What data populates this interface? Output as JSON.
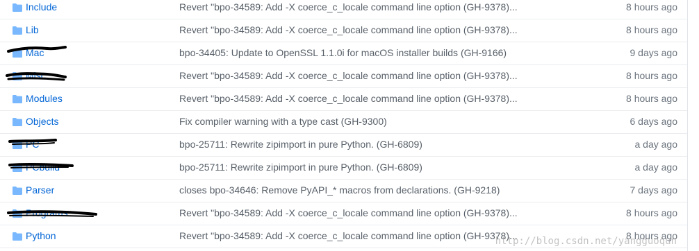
{
  "files": [
    {
      "name": "Include",
      "message": "Revert \"bpo-34589: Add -X coerce_c_locale command line option (GH-9378)...",
      "age": "8 hours ago"
    },
    {
      "name": "Lib",
      "message": "Revert \"bpo-34589: Add -X coerce_c_locale command line option (GH-9378)...",
      "age": "8 hours ago"
    },
    {
      "name": "Mac",
      "message": "bpo-34405: Update to OpenSSL 1.1.0i for macOS installer builds (GH-9166)",
      "age": "9 days ago",
      "redacted": true
    },
    {
      "name": "Misc",
      "message": "Revert \"bpo-34589: Add -X coerce_c_locale command line option (GH-9378)...",
      "age": "8 hours ago",
      "redacted": true
    },
    {
      "name": "Modules",
      "message": "Revert \"bpo-34589: Add -X coerce_c_locale command line option (GH-9378)...",
      "age": "8 hours ago"
    },
    {
      "name": "Objects",
      "message": "Fix compiler warning with a type cast (GH-9300)",
      "age": "6 days ago"
    },
    {
      "name": "PC",
      "message": "bpo-25711: Rewrite zipimport in pure Python. (GH-6809)",
      "age": "a day ago",
      "redacted": true
    },
    {
      "name": "PCbuild",
      "message": "bpo-25711: Rewrite zipimport in pure Python. (GH-6809)",
      "age": "a day ago",
      "redacted": true
    },
    {
      "name": "Parser",
      "message": "closes bpo-34646: Remove PyAPI_* macros from declarations. (GH-9218)",
      "age": "7 days ago"
    },
    {
      "name": "Programs",
      "message": "Revert \"bpo-34589: Add -X coerce_c_locale command line option (GH-9378)...",
      "age": "8 hours ago",
      "redacted": true
    },
    {
      "name": "Python",
      "message": "Revert \"bpo-34589: Add -X coerce_c_locale command line option (GH-9378)...",
      "age": "8 hours ago"
    }
  ],
  "icon": "folder-icon",
  "colors": {
    "link": "#0366d6",
    "folder": "#79b8ff",
    "muted": "#586069",
    "border": "#eaecef"
  },
  "watermark": "http://blog.csdn.net/yangguoqun"
}
